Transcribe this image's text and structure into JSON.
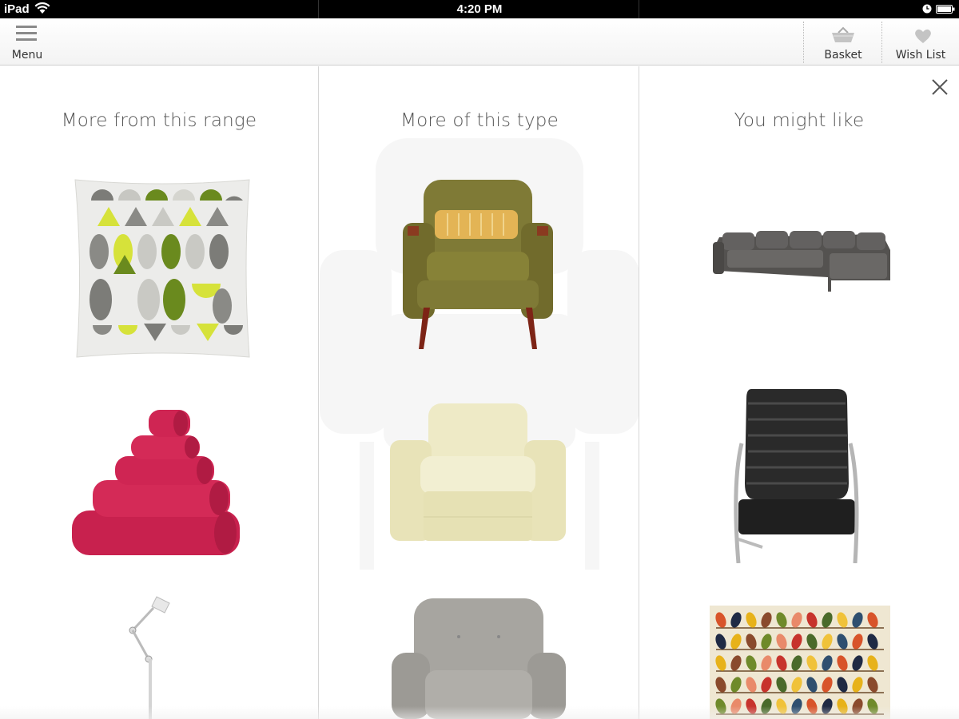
{
  "status_bar": {
    "device": "iPad",
    "time": "4:20 PM"
  },
  "nav": {
    "menu_label": "Menu",
    "basket_label": "Basket",
    "wishlist_label": "Wish List"
  },
  "columns": [
    {
      "title": "More from this range",
      "products": [
        {
          "icon": "patterned-cushion"
        },
        {
          "icon": "pink-towel-stack"
        },
        {
          "icon": "white-floor-lamp"
        }
      ]
    },
    {
      "title": "More of this type",
      "products": [
        {
          "icon": "green-armchair"
        },
        {
          "icon": "cream-armchair"
        },
        {
          "icon": "grey-armchair"
        }
      ]
    },
    {
      "title": "You might like",
      "products": [
        {
          "icon": "grey-corner-sofa"
        },
        {
          "icon": "black-leather-lounge-chair"
        },
        {
          "icon": "multicolour-leaf-rug"
        }
      ]
    }
  ],
  "colors": {
    "status_bar_bg": "#000000",
    "title_text": "#555555",
    "divider": "#d6d6d6"
  }
}
